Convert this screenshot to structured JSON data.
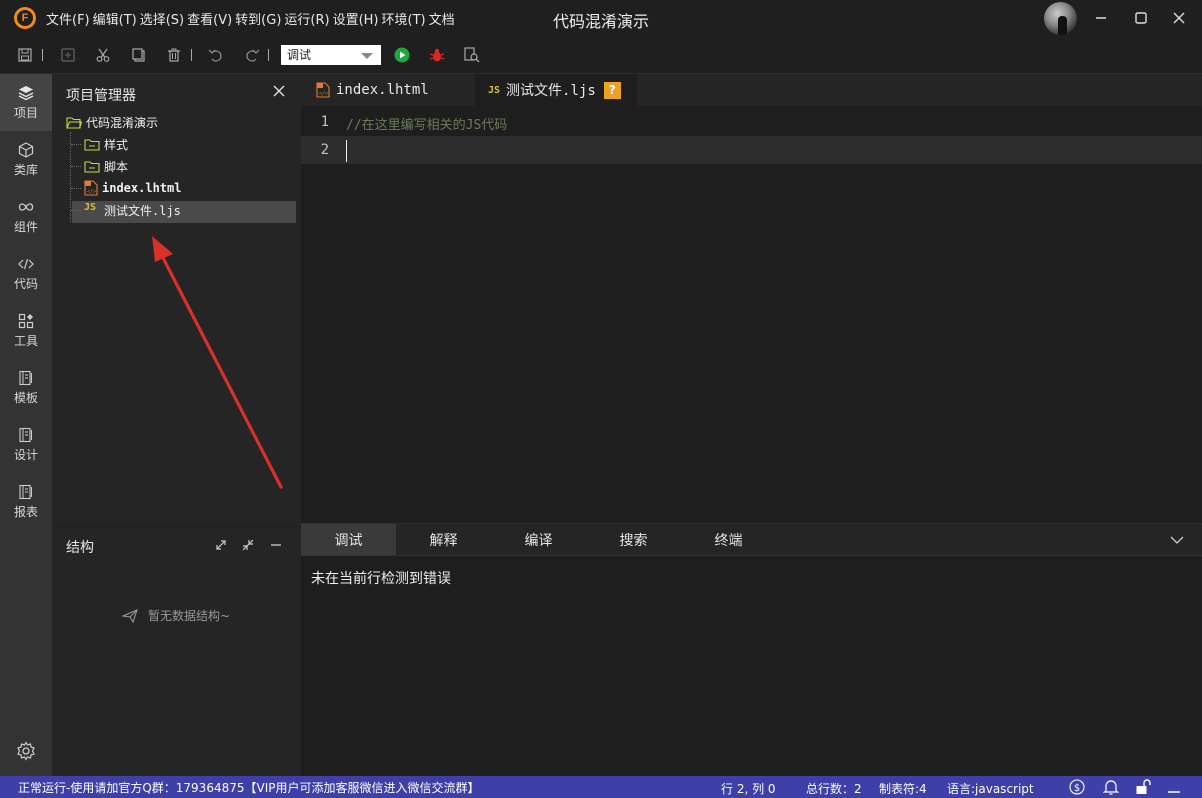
{
  "titlebar": {
    "menus": [
      "文件(F)",
      "编辑(T)",
      "选择(S)",
      "查看(V)",
      "转到(G)",
      "运行(R)",
      "设置(H)",
      "环境(T)",
      "文档"
    ],
    "title": "代码混淆演示"
  },
  "toolbar": {
    "run_config": "调试"
  },
  "activity": {
    "items": [
      {
        "label": "项目",
        "icon": "layers-icon"
      },
      {
        "label": "类库",
        "icon": "cube-icon"
      },
      {
        "label": "组件",
        "icon": "infinity-icon"
      },
      {
        "label": "代码",
        "icon": "code-icon"
      },
      {
        "label": "工具",
        "icon": "grid-icon"
      },
      {
        "label": "模板",
        "icon": "template-icon"
      },
      {
        "label": "设计",
        "icon": "design-icon"
      },
      {
        "label": "报表",
        "icon": "report-icon"
      }
    ]
  },
  "explorer": {
    "title": "项目管理器",
    "root": "代码混淆演示",
    "items": [
      {
        "label": "样式",
        "icon": "folder-icon"
      },
      {
        "label": "脚本",
        "icon": "folder-icon"
      },
      {
        "label": "index.lhtml",
        "icon": "html-file-icon"
      },
      {
        "label": "测试文件.ljs",
        "icon": "js-file-icon",
        "badge": "JS"
      }
    ]
  },
  "structure": {
    "title": "结构",
    "empty": "暂无数据结构~"
  },
  "tabs": [
    {
      "label": "index.lhtml",
      "active": false
    },
    {
      "label": "测试文件.ljs",
      "active": true,
      "badge": "JS",
      "help": "?"
    }
  ],
  "editor": {
    "lines": [
      {
        "no": "1",
        "code": "//在这里编写相关的JS代码"
      },
      {
        "no": "2",
        "code": ""
      }
    ]
  },
  "panel": {
    "tabs": [
      "调试",
      "解释",
      "编译",
      "搜索",
      "终端"
    ],
    "message": "未在当前行检测到错误"
  },
  "status": {
    "left": "正常运行-使用请加官方Q群：179364875【VIP用户可添加客服微信进入微信交流群】",
    "position": "行 2, 列 0",
    "total_lines": "总行数：2",
    "tab_size": "制表符:4",
    "language": "语言:javascript"
  },
  "colors": {
    "statusbar": "#3f3fa8",
    "accent": "#f28a1e",
    "annotation": "#d9302c"
  }
}
